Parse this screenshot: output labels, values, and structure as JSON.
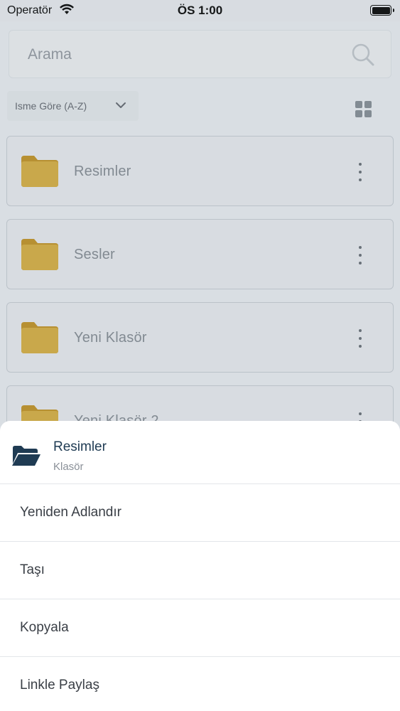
{
  "status_bar": {
    "carrier": "Operatör",
    "time": "ÖS 1:00"
  },
  "search": {
    "placeholder": "Arama"
  },
  "sort": {
    "label": "Isme Göre (A-Z)"
  },
  "folders": [
    {
      "name": "Resimler"
    },
    {
      "name": "Sesler"
    },
    {
      "name": "Yeni Klasör"
    },
    {
      "name": "Yeni Klasör 2"
    }
  ],
  "sheet": {
    "title": "Resimler",
    "subtitle": "Klasör",
    "actions": [
      {
        "label": "Yeniden Adlandır"
      },
      {
        "label": "Taşı"
      },
      {
        "label": "Kopyala"
      },
      {
        "label": "Linkle Paylaş"
      }
    ]
  },
  "colors": {
    "folder": "#ddb54a",
    "sheet_icon": "#1f3b53"
  }
}
